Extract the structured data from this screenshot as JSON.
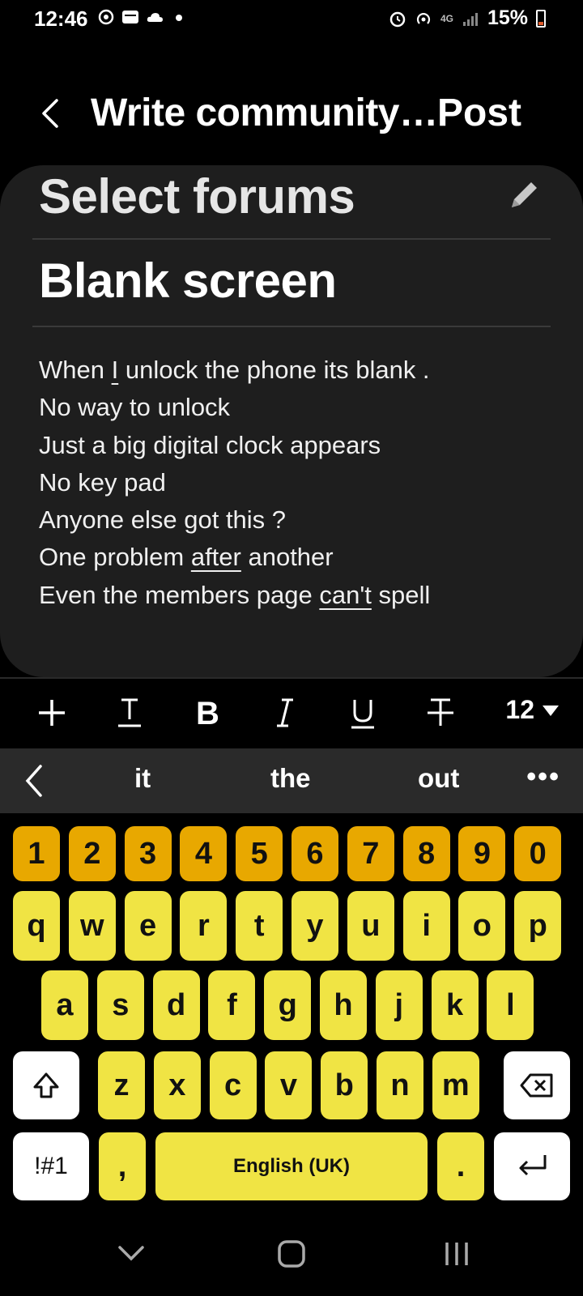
{
  "status_bar": {
    "time": "12:46",
    "network": "4G",
    "battery": "15%"
  },
  "header": {
    "title": "Write community…",
    "post_label": "Post"
  },
  "editor": {
    "forums_label": "Select forums",
    "title": "Blank screen",
    "body_lines": [
      {
        "pre": "When ",
        "u": "I",
        "post": "  unlock the phone its blank ."
      },
      {
        "pre": "No way to unlock",
        "u": "",
        "post": ""
      },
      {
        "pre": "Just a big digital clock appears",
        "u": "",
        "post": ""
      },
      {
        "pre": "No key pad",
        "u": "",
        "post": ""
      },
      {
        "pre": "Anyone else got this ?",
        "u": "",
        "post": ""
      },
      {
        "pre": "One problem ",
        "u": "after",
        "post": " another"
      },
      {
        "pre": "Even the members page ",
        "u": "can't",
        "post": " spell"
      }
    ]
  },
  "format_toolbar": {
    "font_size": "12"
  },
  "suggestions": [
    "it",
    "the",
    "out"
  ],
  "keyboard": {
    "numbers": [
      "1",
      "2",
      "3",
      "4",
      "5",
      "6",
      "7",
      "8",
      "9",
      "0"
    ],
    "row1": [
      "q",
      "w",
      "e",
      "r",
      "t",
      "y",
      "u",
      "i",
      "o",
      "p"
    ],
    "row2": [
      "a",
      "s",
      "d",
      "f",
      "g",
      "h",
      "j",
      "k",
      "l"
    ],
    "row3": [
      "z",
      "x",
      "c",
      "v",
      "b",
      "n",
      "m"
    ],
    "symbols_label": "!#1",
    "comma": ",",
    "space_label": "English (UK)",
    "period": "."
  },
  "colors": {
    "number_key": "#e8a800",
    "letter_key": "#f0e444",
    "card_bg": "#1e1e1e",
    "suggest_bg": "#2a2a2a"
  }
}
